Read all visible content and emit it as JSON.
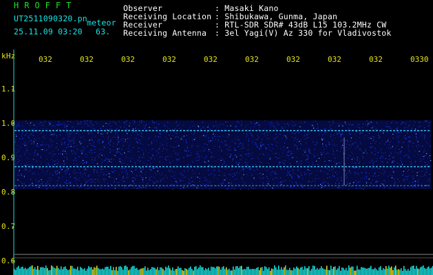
{
  "header": {
    "logo": "HROFFT",
    "filename": "UT2511090320.pn",
    "mode": "meteor",
    "datetime": "25.11.09 03:20",
    "count": "63.",
    "fields": [
      {
        "label": "Observer",
        "value": ": Masaki Kano"
      },
      {
        "label": "Receiving Location",
        "value": ": Shibukawa, Gunma, Japan"
      },
      {
        "label": "Receiver",
        "value": ": RTL-SDR SDR# 43dB L15 103.2MHz CW"
      },
      {
        "label": "Receiving Antenna",
        "value": ": 3el Yagi(V) Az 330 for Vladivostok"
      }
    ]
  },
  "chart_data": {
    "type": "heatmap",
    "ylabel": "kHz",
    "y_ticks": [
      "1.1",
      "1.0",
      "0.9",
      "0.8",
      "0.7",
      "0.6"
    ],
    "ylim": [
      0.58,
      1.2
    ],
    "x_ticks": [
      "032",
      "032",
      "032",
      "032",
      "032",
      "032",
      "032",
      "032",
      "032",
      "0330"
    ],
    "noise_band_khz": [
      0.81,
      1.01
    ],
    "carrier_lines_khz": [
      0.98,
      0.875,
      0.82
    ],
    "baseline_khz": 0.62,
    "colors": {
      "background": "#000000",
      "noise": "#1a3cff",
      "line": "#3cd6ff",
      "axis": "#19e6e6",
      "tick_text": "#e6e619",
      "bar": "#19e6e6"
    }
  }
}
